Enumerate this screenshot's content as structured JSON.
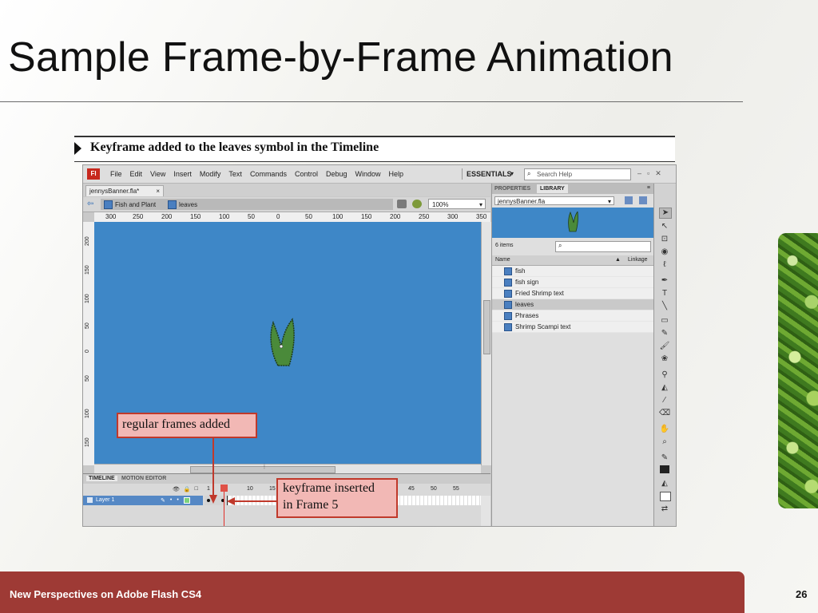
{
  "slide": {
    "title": "Sample Frame-by-Frame Animation",
    "footer": "New Perspectives on Adobe Flash CS4",
    "page_number": "26"
  },
  "figure": {
    "caption": "Keyframe added to the leaves symbol in the Timeline"
  },
  "app": {
    "logo": "Fl",
    "menu": [
      "File",
      "Edit",
      "View",
      "Insert",
      "Modify",
      "Text",
      "Commands",
      "Control",
      "Debug",
      "Window",
      "Help"
    ],
    "workspace": "ESSENTIALS",
    "search_placeholder": "Search Help",
    "window_buttons": [
      "–",
      "▫",
      "✕"
    ],
    "doc_tab": "jennysBanner.fla*",
    "breadcrumbs": [
      "Fish and Plant",
      "leaves"
    ],
    "zoom": "100%",
    "ruler_top": [
      "300",
      "250",
      "200",
      "150",
      "100",
      "50",
      "0",
      "50",
      "100",
      "150",
      "200",
      "250",
      "300",
      "350"
    ],
    "ruler_left": [
      "200",
      "150",
      "100",
      "50",
      "0",
      "50",
      "100",
      "150"
    ]
  },
  "timeline": {
    "tabs": [
      "TIMELINE",
      "MOTION EDITOR"
    ],
    "frame_numbers": [
      "1",
      "5",
      "10",
      "15",
      "45",
      "50",
      "55"
    ],
    "layer_name": "Layer 1",
    "filled_frames": 5,
    "keyframes": [
      1,
      5
    ]
  },
  "library": {
    "tabs": [
      "PROPERTIES",
      "LIBRARY"
    ],
    "file": "jennysBanner.fla",
    "item_count": "6 items",
    "columns": [
      "Name",
      "Linkage"
    ],
    "items": [
      {
        "name": "fish",
        "selected": false
      },
      {
        "name": "fish sign",
        "selected": false
      },
      {
        "name": "Fried Shrimp text",
        "selected": false
      },
      {
        "name": "leaves",
        "selected": true
      },
      {
        "name": "Phrases",
        "selected": false
      },
      {
        "name": "Shrimp Scampi text",
        "selected": false
      }
    ]
  },
  "tools": [
    "selection-tool",
    "subselection-tool",
    "free-transform-tool",
    "3d-rotation-tool",
    "lasso-tool",
    "pen-tool",
    "text-tool",
    "line-tool",
    "rectangle-tool",
    "pencil-tool",
    "brush-tool",
    "deco-tool",
    "bone-tool",
    "paint-bucket-tool",
    "eyedropper-tool",
    "eraser-tool",
    "hand-tool",
    "zoom-tool",
    "stroke-color",
    "fill-color"
  ],
  "callouts": {
    "regular_frames": "regular frames added",
    "keyframe_line1": "keyframe inserted",
    "keyframe_line2": "in Frame 5"
  },
  "colors": {
    "stage": "#3e87c7",
    "footer": "#9e3a35",
    "callout_fill": "#f2b8b5",
    "callout_border": "#c0392b",
    "layer_highlight": "#5588c5"
  }
}
